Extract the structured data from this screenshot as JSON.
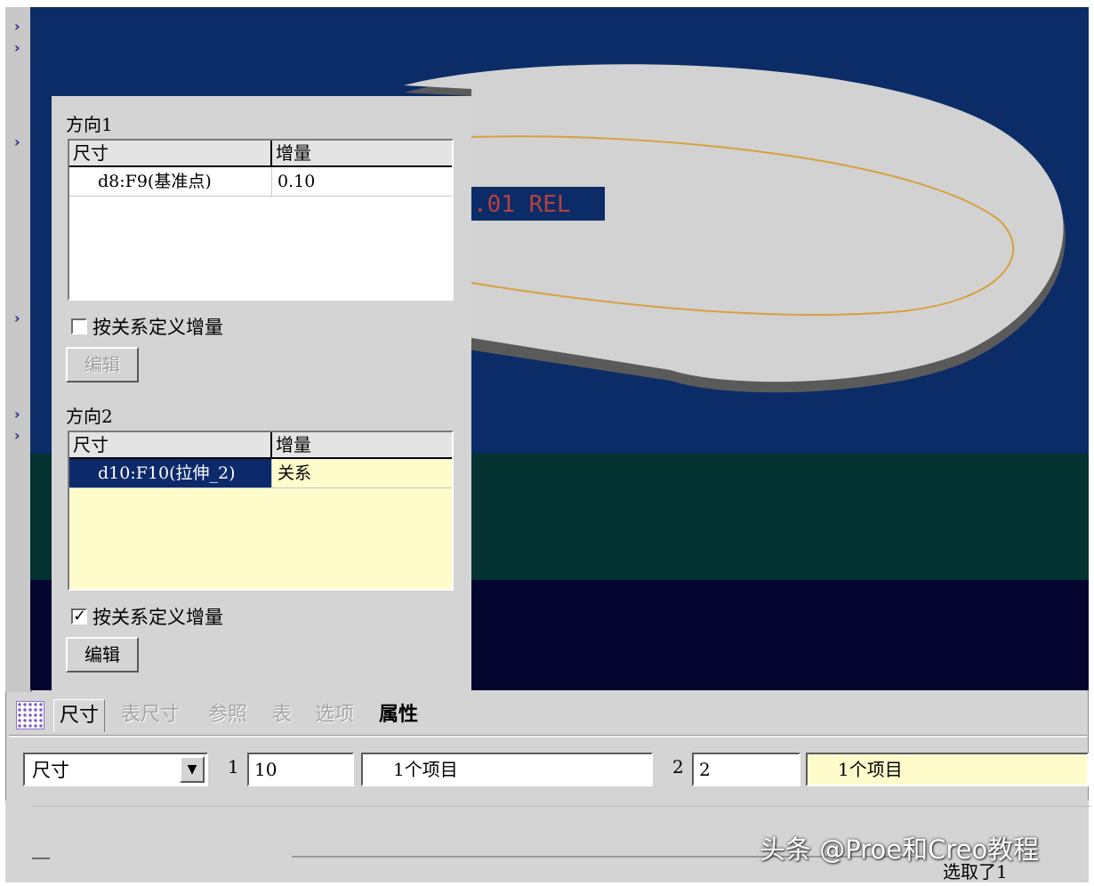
{
  "direction1": {
    "label": "方向1",
    "table": {
      "headers": [
        "尺寸",
        "增量"
      ],
      "rows": [
        {
          "dimension": "d8:F9(基准点)",
          "increment": "0.10"
        }
      ]
    },
    "checkbox_label": "按关系定义增量",
    "checkbox_checked": false,
    "edit_button": "编辑"
  },
  "direction2": {
    "label": "方向2",
    "table": {
      "headers": [
        "尺寸",
        "增量"
      ],
      "rows": [
        {
          "dimension": "d10:F10(拉伸_2)",
          "increment": "关系"
        }
      ]
    },
    "checkbox_label": "按关系定义增量",
    "checkbox_checked": true,
    "checkbox_mark": "✓",
    "edit_button": "编辑"
  },
  "viewport": {
    "label_text": ".01 REL"
  },
  "tabs": [
    "尺寸",
    "表尺寸",
    "参照",
    "表",
    "选项",
    "属性"
  ],
  "bottom": {
    "selector": "尺寸",
    "label1": "1",
    "value1": "10",
    "info1": "1个项目",
    "label2": "2",
    "value2": "2",
    "info2": "1个项目"
  },
  "status": "选取了1",
  "watermark": "头条 @Proe和Creo教程",
  "icons": {
    "rail": "chevron-right-icon",
    "tab_grid": "grid-icon",
    "dropdown": "triangle-down-icon"
  },
  "colors": {
    "viewport_blue": "#0b2c66",
    "selected_row": "#0c2a6a",
    "yellow_fill": "#fffccc",
    "curve": "#d8a040"
  }
}
